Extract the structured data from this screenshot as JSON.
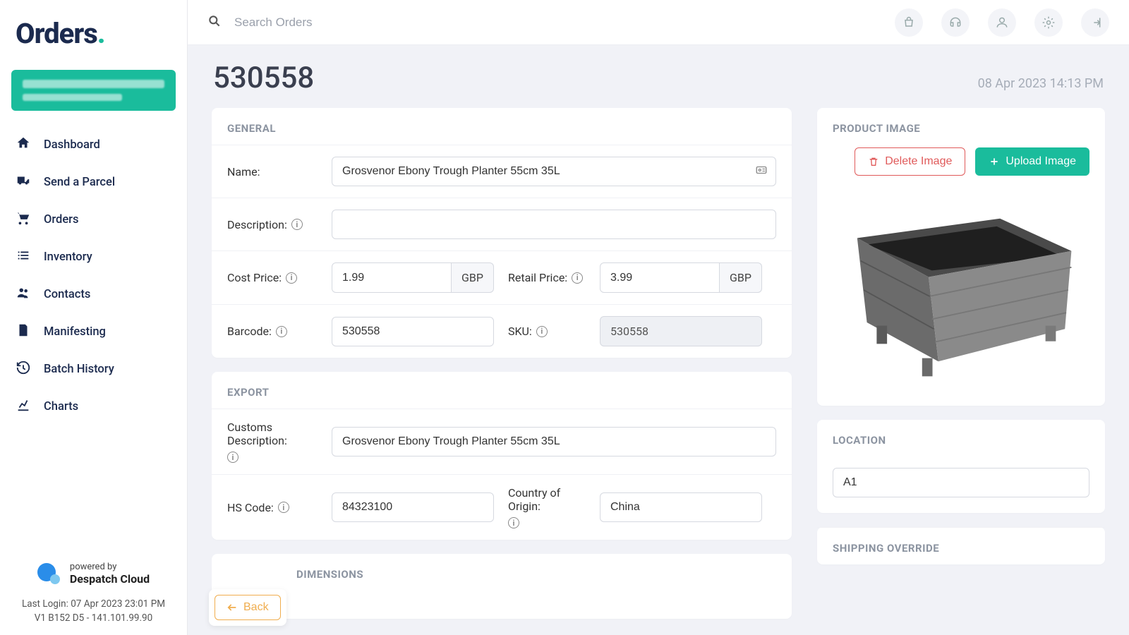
{
  "brand": {
    "name": "Orders",
    "dot": "."
  },
  "sidebar": {
    "items": [
      {
        "label": "Dashboard"
      },
      {
        "label": "Send a Parcel"
      },
      {
        "label": "Orders"
      },
      {
        "label": "Inventory"
      },
      {
        "label": "Contacts"
      },
      {
        "label": "Manifesting"
      },
      {
        "label": "Batch History"
      },
      {
        "label": "Charts"
      }
    ],
    "powered_by_small": "powered by",
    "powered_by_brand": "Despatch Cloud",
    "last_login": "Last Login: 07 Apr 2023 23:01 PM",
    "version": "V1 B152 D5 - 141.101.99.90"
  },
  "search": {
    "placeholder": "Search Orders"
  },
  "page": {
    "title": "530558",
    "datetime": "08 Apr 2023 14:13 PM"
  },
  "general": {
    "header": "GENERAL",
    "name_label": "Name:",
    "name_value": "Grosvenor Ebony Trough Planter 55cm 35L",
    "description_label": "Description:",
    "description_value": "",
    "cost_price_label": "Cost Price:",
    "cost_price_value": "1.99",
    "cost_price_currency": "GBP",
    "retail_price_label": "Retail Price:",
    "retail_price_value": "3.99",
    "retail_price_currency": "GBP",
    "barcode_label": "Barcode:",
    "barcode_value": "530558",
    "sku_label": "SKU:",
    "sku_value": "530558"
  },
  "export": {
    "header": "EXPORT",
    "customs_desc_label": "Customs Description:",
    "customs_desc_value": "Grosvenor Ebony Trough Planter 55cm 35L",
    "hs_code_label": "HS Code:",
    "hs_code_value": "84323100",
    "coo_label": "Country of Origin:",
    "coo_value": "China"
  },
  "dimensions": {
    "header": "DIMENSIONS"
  },
  "product_image": {
    "header": "PRODUCT IMAGE",
    "delete_label": "Delete Image",
    "upload_label": "Upload Image"
  },
  "location": {
    "header": "LOCATION",
    "value": "A1"
  },
  "shipping": {
    "header": "SHIPPING OVERRIDE"
  },
  "back": {
    "label": "Back"
  },
  "info_glyph": "i"
}
